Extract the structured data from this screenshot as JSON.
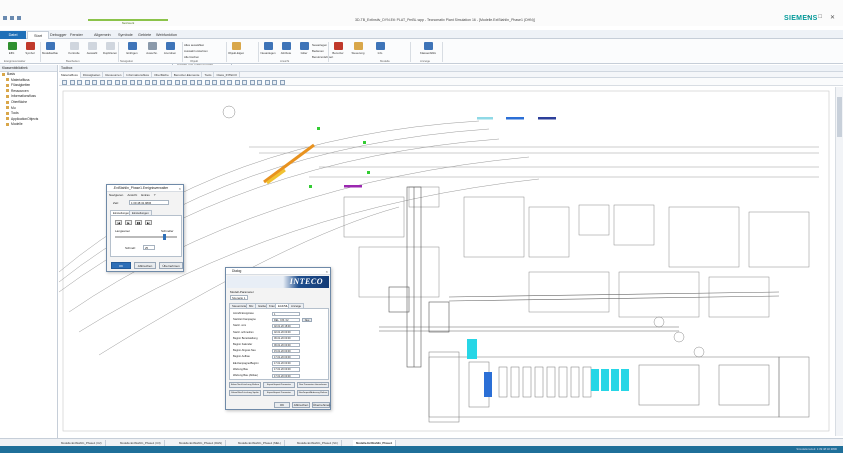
{
  "window": {
    "title": "3D-TB_ExtInstlv_DYN.Etl: PLAT_PmBL.wpp - Tecnomatix Plant Simulation 16 - [Modelle.ExtStahlIn_Phase1 (DHN)]",
    "brand": "SIEMENS",
    "controls": [
      "–",
      "□",
      "✕"
    ]
  },
  "context_tab_header": "Netzwerk",
  "tabs": [
    {
      "label": "Datei"
    },
    {
      "label": "Start"
    },
    {
      "label": "Debugger"
    },
    {
      "label": "Fenster"
    },
    {
      "label": "Allgemein"
    },
    {
      "label": "Symbole"
    },
    {
      "label": "Gebiete"
    },
    {
      "label": "Webfunktion"
    }
  ],
  "search": {
    "placeholder": "Planen Sie Datei suchen"
  },
  "ribbon": {
    "buttons": [
      {
        "label": "Effiz.",
        "icon": "play-icon",
        "color": "#2f8f2f"
      },
      {
        "label": "Symbol",
        "icon": "stop-icon",
        "color": "#c0392b"
      },
      {
        "label": "Modellaufbau",
        "icon": "model-icon",
        "color": "#3e74b8"
      },
      {
        "label": "Kontrolle",
        "icon": "check-icon",
        "color": "#d0d6de"
      },
      {
        "label": "Auswahl",
        "icon": "select-icon",
        "color": "#d0d6de"
      },
      {
        "label": "Duplizieren",
        "icon": "duplicate-icon",
        "color": "#d0d6de"
      },
      {
        "label": "Einfügen",
        "icon": "paste-icon",
        "color": "#3e74b8"
      },
      {
        "label": "Ausschn.",
        "icon": "cut-icon",
        "color": "#8a99aa"
      },
      {
        "label": "Anordnen",
        "icon": "arrange-icon",
        "color": "#3e74b8"
      },
      {
        "label": "Objekt-Eigenschaften",
        "icon": "properties-icon",
        "color": "#d9a74a"
      },
      {
        "label": "Neuanlegen",
        "icon": "new-icon",
        "color": "#3e74b8"
      },
      {
        "label": "Attribute",
        "icon": "attribute-icon",
        "color": "#3e74b8"
      },
      {
        "label": "Gitter",
        "icon": "grid-icon",
        "color": "#3e74b8"
      },
      {
        "label": "Benutzer",
        "icon": "user-icon",
        "color": "#c0392b"
      },
      {
        "label": "Steuerung",
        "icon": "control-icon",
        "color": "#d9a74a"
      },
      {
        "label": "Info",
        "icon": "info-icon",
        "color": "#3e74b8"
      },
      {
        "label": "Klassenbibliothek anzeigen",
        "icon": "library-icon",
        "color": "#3e74b8"
      }
    ],
    "small_items": [
      "Alles auswählen",
      "Auswahl umkehren",
      "Alle löschen",
      "Neuanlegen",
      "Bedienen",
      "Benutzerdefiniert"
    ],
    "groups": [
      "Ereignisverwalter",
      "Bearbeiten",
      "Navigation",
      "Objekt",
      "Ansicht",
      "Modelle",
      "Anzeige"
    ]
  },
  "left_panel": {
    "title": "Klassenbibliothek",
    "root": "Basis",
    "items": [
      "Materialfluss",
      "Flüssigkeiten",
      "Ressourcen",
      "Informationsfluss",
      "Oberfläche",
      "Mu",
      "Tools",
      "ApplicationObjects",
      "Modelle"
    ]
  },
  "main_panel": {
    "title": "Toolbox",
    "doc_tabs": [
      "Materialfluss",
      "Flüssigkeiten",
      "Ressourcen",
      "Informationsfluss",
      "Oberfläche",
      "Benutzer-Elemente",
      "Tools",
      "Class_INTECO"
    ]
  },
  "dialog_small": {
    "title": ".ExtStahlIn_Phase1.Ereignisverwalter",
    "menu": [
      "Navigieren",
      "Ansicht",
      "Extras",
      "?"
    ],
    "time_label": "Zeit:",
    "time_value": "1:09:48:32.9806",
    "tabs": [
      "Einstellungen",
      "Einstellungen"
    ],
    "left_label": "Langsamer",
    "right_label": "Schneller",
    "step_label": "Schnell:",
    "step_value": "25",
    "buttons": [
      "OK",
      "Abbrechen",
      "Übernehmen"
    ]
  },
  "dialog_inteco": {
    "title": "Dialog",
    "logo": "INTECO",
    "dropdown_label": "Modell-Parameter",
    "dropdown_value": "Szenario 1",
    "tabs": [
      "Steuerzeiten",
      "Mix",
      "Gießen",
      "Kran",
      "EAF/ML",
      "Anzeige"
    ],
    "rows": [
      {
        "label": "Anzahl Ereignisse",
        "value": "1"
      },
      {
        "label": "Startzeit Kampagne",
        "value": "DEL_KIS_02",
        "button": "Neu"
      },
      {
        "label": "Startz. vom",
        "value": "02.01.20 18:00"
      },
      {
        "label": "Startz. schmelzen",
        "value": "02.01.20 00:00"
      },
      {
        "label": "Beginn Bereitstellung",
        "value": "06.01.20 00:00"
      },
      {
        "label": "Beginn Kalender",
        "value": "06.01.20 00:00"
      },
      {
        "label": "Beginn Abguss Neu",
        "value": "15.01.20 00:00"
      },
      {
        "label": "Beginn Aufbau",
        "value": "17.01.20 00:00"
      },
      {
        "label": "EE-Kampagne/Beginn",
        "value": "17.01.20 00:00"
      },
      {
        "label": "Wartung Bau",
        "value": "17.01.20 00:00"
      },
      {
        "label": "Wartung Bau (Abbau)",
        "value": "17.01.20 00:00"
      }
    ],
    "action_buttons": [
      "Erbau Neu/Löschung Reihen",
      "Export/Import-Parameter",
      "Neu Parameter übernehmen",
      "Erbau/Neu/Löschung Spalte",
      "Export/Import Parameter",
      "Neu/Import/Änderung Reihen"
    ],
    "buttons": [
      "OK",
      "Abbrechen",
      "Übernehmen"
    ]
  },
  "sheet_tabs": [
    {
      "label": "Modelle.ExtStahlIn_Phase1 (C2)"
    },
    {
      "label": "Modelle.ExtStahlIn_Phase1 (C3)"
    },
    {
      "label": "Modelle.ExtStahlIn_Phase1 (DHN)"
    },
    {
      "label": "Modelle.ExtStahlIn_Phase1 (MEL)"
    },
    {
      "label": "Modelle.ExtStahlIn_Phase1 (SC)"
    },
    {
      "label": "Modelle.ExtStahlIn_Phase1",
      "active": true
    }
  ],
  "status_right": "Simulationszeit: 1:09:48:32.9806",
  "colors": {
    "accent": "#1e6fb8",
    "brand": "#009999",
    "bottom_bar": "#1f6f99",
    "cyan_store": "#27d6e6",
    "blue_store": "#2b6fd6",
    "purple_marker": "#9b27b0",
    "track_orange": "#e8921f",
    "track_yellow": "#f1c232",
    "green_marker": "#33cc33"
  }
}
